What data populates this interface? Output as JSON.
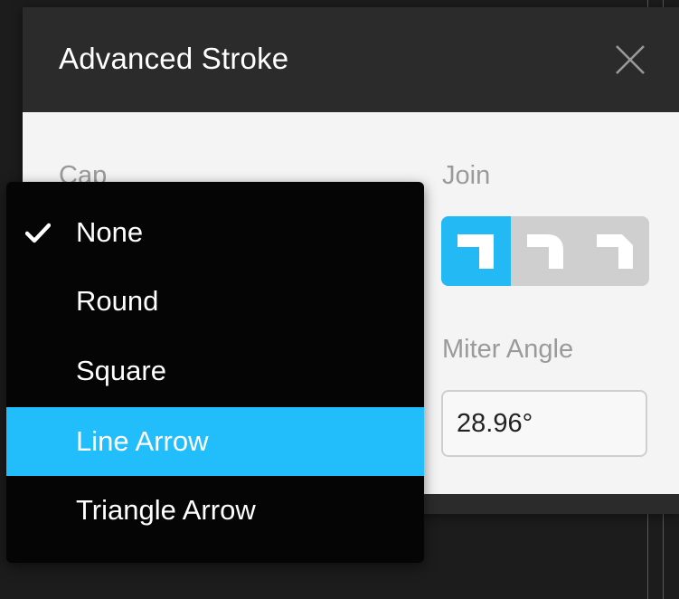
{
  "dialog": {
    "title": "Advanced Stroke",
    "close_icon": "close-icon"
  },
  "cap": {
    "label": "Cap",
    "options": [
      {
        "label": "None",
        "checked": true
      },
      {
        "label": "Round",
        "checked": false
      },
      {
        "label": "Square",
        "checked": false
      },
      {
        "label": "Line Arrow",
        "checked": false,
        "highlighted": true
      },
      {
        "label": "Triangle Arrow",
        "checked": false
      }
    ],
    "check_icon": "checkmark-icon"
  },
  "join": {
    "label": "Join",
    "options": [
      {
        "name": "miter-join-icon",
        "active": true
      },
      {
        "name": "round-join-icon",
        "active": false
      },
      {
        "name": "bevel-join-icon",
        "active": false
      }
    ]
  },
  "miter": {
    "label": "Miter Angle",
    "value": "28.96°"
  },
  "colors": {
    "accent": "#22bdfb",
    "header": "#2b2b2b",
    "menu": "#050505",
    "panel": "#f4f4f4"
  }
}
